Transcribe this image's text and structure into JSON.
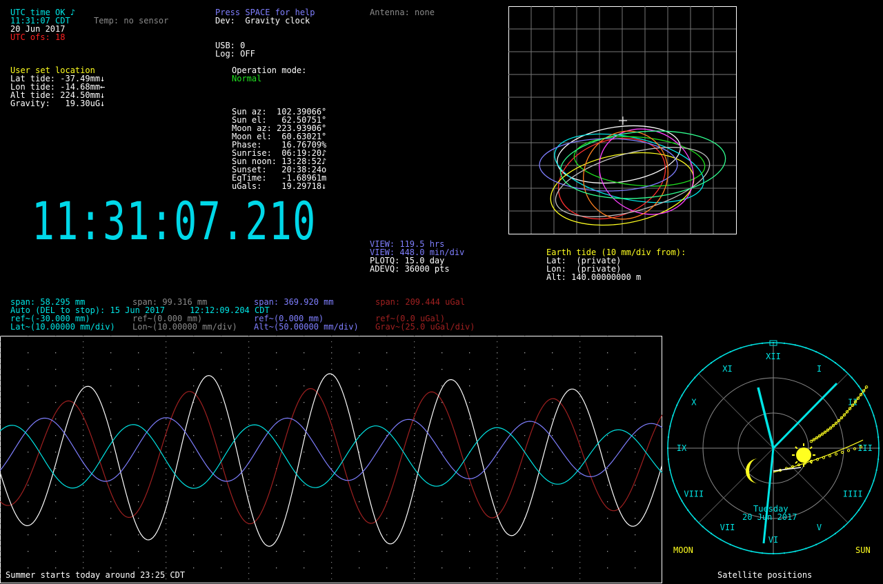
{
  "status": {
    "utc_ok": "UTC time OK ♪",
    "local_time": "11:31:07 CDT",
    "date": "20 Jun 2017",
    "utc_offset": "UTC ofs: 18",
    "temp": "Temp: no sensor"
  },
  "header": {
    "help": "Press SPACE for help",
    "device": "Dev:  Gravity clock",
    "antenna": "Antenna: none",
    "usb": "USB: 0",
    "log": "Log: OFF",
    "mode_label": "Operation mode:",
    "mode_value": "Normal"
  },
  "location": {
    "title": "User set location",
    "lines": [
      "Lat tide: -37.49mm↓",
      "Lon tide: -14.68mm←",
      "Alt tide: 224.50mm↓",
      "Gravity:   19.30uG↓"
    ]
  },
  "astro": [
    "Sun az:  102.39066°",
    "Sun el:   62.50751°",
    "Moon az: 223.93906°",
    "Moon el:  60.63021°",
    "Phase:    16.76709%",
    "Sunrise:  06:19:20♪",
    "Sun noon: 13:28:52♪",
    "Sunset:   20:38:24o",
    "EqTime:   -1.68961m",
    "uGals:    19.29718↓"
  ],
  "big_clock": "11:31:07.210",
  "view": {
    "view_hrs": "VIEW: 119.5 hrs",
    "view_div": "VIEW: 448.0 min/div",
    "plotq": "PLOTQ: 15.0 day",
    "adevq": "ADEVQ: 36000 pts"
  },
  "earth_tide": {
    "title": "Earth tide (10 mm/div from):",
    "lat": "Lat:  (private)",
    "lon": "Lon:  (private)",
    "alt": "Alt: 140.00000000 m"
  },
  "legend": {
    "span_lat": "span: 58.295 mm",
    "span_lon": "span: 99.316 mm",
    "span_alt": "span: 369.920 mm",
    "span_grav": "span: 209.444 uGal",
    "auto": "Auto (DEL to stop): 15 Jun 2017     12:12:09.204 CDT",
    "ref_lat": "ref~(-30.000 mm)",
    "ref_lon": "ref~(0.000 mm)",
    "ref_alt": "ref~(0.000 mm)",
    "ref_grav": "ref~(0.0 uGal)",
    "scale_lat": "Lat~(10.00000 mm/div)",
    "scale_lon": "Lon~(10.00000 mm/div)",
    "scale_alt": "Alt~(50.00000 mm/div)",
    "scale_grav": "Grav~(25.0 uGal/div)"
  },
  "plot_message": "Summer starts today around 23:25 CDT",
  "sky": {
    "numerals": [
      "XII",
      "I",
      "II",
      "III",
      "IIII",
      "V",
      "VI",
      "VII",
      "VIII",
      "IX",
      "X",
      "XI"
    ],
    "day": "Tuesday",
    "date": "20 Jun 2017",
    "moon_label": "MOON",
    "sun_label": "SUN",
    "caption": "Satellite positions"
  },
  "colors": {
    "lat": "#00e5e5",
    "lon": "#ffffff",
    "alt": "#7f7fff",
    "grav": "#a02020"
  }
}
